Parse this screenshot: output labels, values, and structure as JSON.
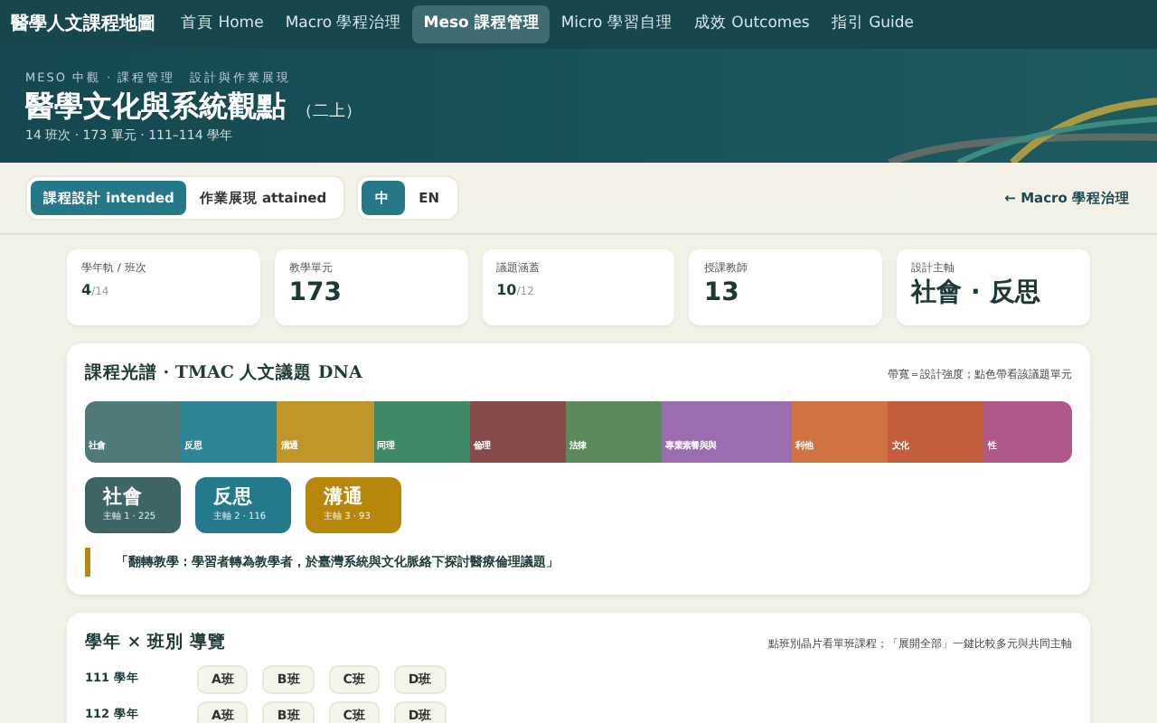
{
  "nav": {
    "brand": "醫學人文課程地圖",
    "items": [
      {
        "label": "首頁 Home",
        "selected": false
      },
      {
        "label": "Macro 學程治理",
        "selected": false
      },
      {
        "label": "Meso 課程管理",
        "selected": true
      },
      {
        "label": "Micro 學習自理",
        "selected": false
      },
      {
        "label": "成效 Outcomes",
        "selected": false
      },
      {
        "label": "指引 Guide",
        "selected": false
      }
    ]
  },
  "hero": {
    "breadcrumb": "MESO 中觀 · 課程管理　設計與作業展現",
    "title": "醫學文化與系統觀點",
    "subtitle": "（二上）",
    "meta": "14 班次 · 173 單元 · 111–114 學年"
  },
  "toolbar": {
    "modes": [
      {
        "label": "課程設計 intended",
        "selected": true
      },
      {
        "label": "作業展現 attained",
        "selected": false
      }
    ],
    "langs": [
      {
        "label": "中",
        "selected": true
      },
      {
        "label": "EN",
        "selected": false
      }
    ],
    "back_link": "← Macro 學程治理"
  },
  "stats": [
    {
      "label": "學年軌 / 班次",
      "value": "4",
      "suffix": "/14",
      "kind": "small"
    },
    {
      "label": "教學單元",
      "value": "173",
      "kind": "big"
    },
    {
      "label": "議題涵蓋",
      "value": "10",
      "suffix": "/12",
      "kind": "small"
    },
    {
      "label": "授課教師",
      "value": "13",
      "kind": "big"
    },
    {
      "label": "設計主軸",
      "value": "社會 · 反思",
      "kind": "big"
    }
  ],
  "spectrum": {
    "title": "課程光譜 · TMAC 人文議題 DNA",
    "hint": "帶寬＝設計強度；點色帶看該議題單元",
    "segments": [
      {
        "label": "社會",
        "color": "#4f7a7a"
      },
      {
        "label": "反思",
        "color": "#2e8597"
      },
      {
        "label": "溝通",
        "color": "#c0952a"
      },
      {
        "label": "同理",
        "color": "#3f8a66"
      },
      {
        "label": "倫理",
        "color": "#874a4a"
      },
      {
        "label": "法律",
        "color": "#5a8a5c"
      },
      {
        "label": "專業素養與與",
        "color": "#9a6cb0"
      },
      {
        "label": "利他",
        "color": "#cf7440"
      },
      {
        "label": "文化",
        "color": "#c45c3e"
      },
      {
        "label": "性",
        "color": "#b0588a"
      }
    ],
    "axes": [
      {
        "name": "社會",
        "detail": "主軸 1 · 225",
        "color": "#3d6565"
      },
      {
        "name": "反思",
        "detail": "主軸 2 · 116",
        "color": "#237a8c"
      },
      {
        "name": "溝通",
        "detail": "主軸 3 · 93",
        "color": "#b8860b"
      }
    ],
    "quote": "「翻轉教學：學習者轉為教學者，於臺灣系統與文化脈絡下探討醫療倫理議題」"
  },
  "classes": {
    "title": "學年 × 班別 導覽",
    "hint": "點班別晶片看單班課程；「展開全部」一鍵比較多元與共同主軸",
    "years": [
      {
        "label": "111 學年",
        "chips": [
          "A班",
          "B班",
          "C班",
          "D班"
        ]
      },
      {
        "label": "112 學年",
        "chips": [
          "A班",
          "B班",
          "C班",
          "D班"
        ]
      }
    ]
  }
}
